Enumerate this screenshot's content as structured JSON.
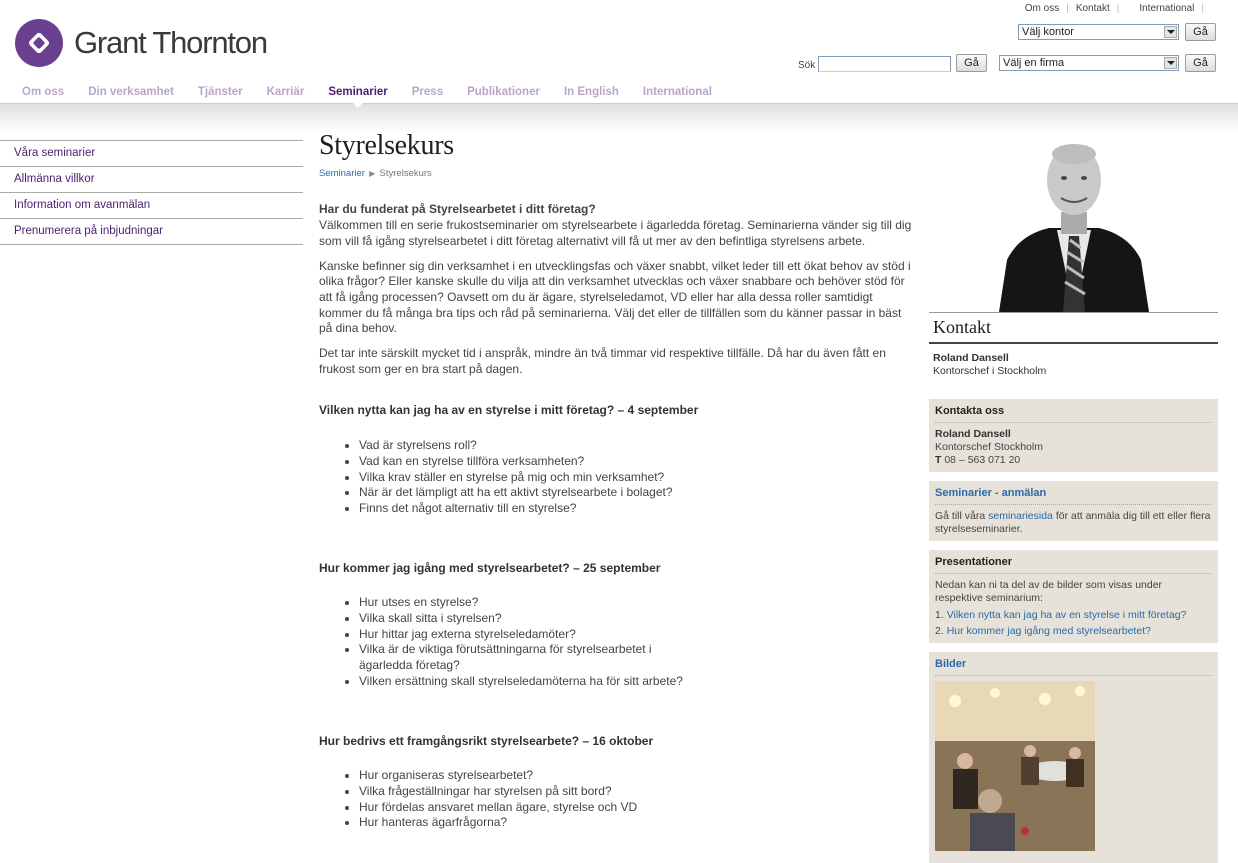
{
  "header": {
    "logo_text": "Grant Thornton",
    "util_links": [
      "Om oss",
      "Kontakt",
      "International"
    ],
    "office_select": "Välj kontor",
    "firm_select": "Välj en firma",
    "go_label": "Gå",
    "search_label": "Sök",
    "search_value": ""
  },
  "nav": {
    "items": [
      "Om oss",
      "Din verksamhet",
      "Tjänster",
      "Karriär",
      "Seminarier",
      "Press",
      "Publikationer",
      "In English",
      "International"
    ],
    "active": "Seminarier"
  },
  "sidebar": {
    "items": [
      "Våra seminarier",
      "Allmänna villkor",
      "Information om avanmälan",
      "Prenumerera på inbjudningar"
    ]
  },
  "main": {
    "title": "Styrelsekurs",
    "breadcrumb": [
      "Seminarier",
      "Styrelsekurs"
    ],
    "intro_question": "Har du funderat på Styrelsearbetet i ditt företag?",
    "intro_text": "Välkommen till en serie frukostseminarier om styrelsearbete i ägarledda företag. Seminarierna vänder sig till dig som vill få igång styrelsearbetet i ditt företag alternativt vill få ut mer av den befintliga styrelsens arbete.",
    "para2": "Kanske befinner sig din verksamhet i en utvecklingsfas och växer snabbt, vilket leder till ett ökat behov av stöd i olika frågor? Eller kanske skulle du vilja att din verksamhet utvecklas och växer snabbare och behöver stöd för att få igång processen?  Oavsett om du är ägare, styrelseledamot, VD eller har alla dessa roller samtidigt kommer du få många bra tips och råd på seminarierna. Välj det eller de tillfällen som du känner passar in bäst på dina behov.",
    "para3": "Det tar inte särskilt mycket tid i anspråk, mindre än två timmar vid respektive tillfälle. Då har du även fått en frukost som ger en bra start på dagen.",
    "sections": [
      {
        "heading": "Vilken nytta kan jag ha av en styrelse i mitt företag? – 4 september",
        "items": [
          "Vad är styrelsens roll?",
          "Vad kan en styrelse tillföra verksamheten?",
          "Vilka krav ställer en styrelse på mig och min verksamhet?",
          "När är det lämpligt att ha ett aktivt styrelsearbete i bolaget?",
          "Finns det något alternativ till en styrelse?"
        ]
      },
      {
        "heading": "Hur kommer jag igång med styrelsearbetet? – 25 september",
        "items": [
          "Hur utses en styrelse?",
          "Vilka skall sitta i styrelsen?",
          "Hur hittar jag externa styrelseledamöter?",
          "Vilka är de viktiga förutsättningarna för styrelsearbetet i ägarledda företag?",
          "Vilken ersättning skall styrelseledamöterna ha för sitt arbete?"
        ]
      },
      {
        "heading": "Hur bedrivs ett framgångsrikt styrelsearbete? – 16 oktober",
        "items": [
          "Hur organiseras styrelsearbetet?",
          "Vilka frågeställningar har styrelsen på sitt bord?",
          "Hur fördelas ansvaret mellan ägare, styrelse och VD",
          "Hur hanteras ägarfrågorna?"
        ]
      }
    ]
  },
  "right": {
    "kontakt_title": "Kontakt",
    "contact_name": "Roland Dansell",
    "contact_role": "Kontorschef i Stockholm",
    "box_contact": {
      "title": "Kontakta oss",
      "name": "Roland Dansell",
      "role": "Kontorschef Stockholm",
      "phone_prefix": "T",
      "phone": "08 – 563 071 20"
    },
    "box_seminar": {
      "title": "Seminarier - anmälan",
      "text_before": "Gå till våra",
      "link": "seminariesida",
      "text_after": "för att anmäla dig till ett eller flera styrelseseminarier."
    },
    "box_pres": {
      "title": "Presentationer",
      "text": "Nedan kan ni ta del av de bilder som visas under respektive seminarium:",
      "items": [
        {
          "num": "1.",
          "label": "Vilken nytta kan jag ha av en styrelse i mitt företag?"
        },
        {
          "num": "2.",
          "label": "Hur kommer jag igång med styrelsearbetet?"
        }
      ]
    },
    "box_bilder": {
      "title": "Bilder"
    }
  },
  "colors": {
    "brand_purple": "#4a1f6e",
    "nav_inactive": "#b8a5c8",
    "link_blue": "#2a6aa8",
    "box_beige": "#e7e2d9"
  }
}
